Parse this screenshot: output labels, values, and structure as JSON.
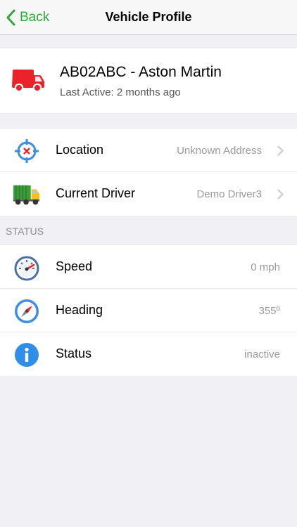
{
  "navbar": {
    "back_label": "Back",
    "title": "Vehicle Profile"
  },
  "vehicle": {
    "name": "AB02ABC - Aston Martin",
    "last_active": "Last Active: 2 months ago",
    "icon": "van-icon"
  },
  "info_rows": [
    {
      "label": "Location",
      "value": "Unknown Address",
      "icon": "location-target-icon"
    },
    {
      "label": "Current Driver",
      "value": "Demo Driver3",
      "icon": "truck-icon"
    }
  ],
  "status_section": {
    "header": "STATUS",
    "rows": [
      {
        "label": "Speed",
        "value": "0 mph",
        "icon": "speedometer-icon"
      },
      {
        "label": "Heading",
        "value": "355º",
        "icon": "compass-icon"
      },
      {
        "label": "Status",
        "value": "inactive",
        "icon": "info-icon"
      }
    ]
  },
  "colors": {
    "accent": "#2faa3c",
    "background": "#efeff4",
    "van_red": "#e8232a",
    "secondary_text": "#9a9a9f"
  }
}
